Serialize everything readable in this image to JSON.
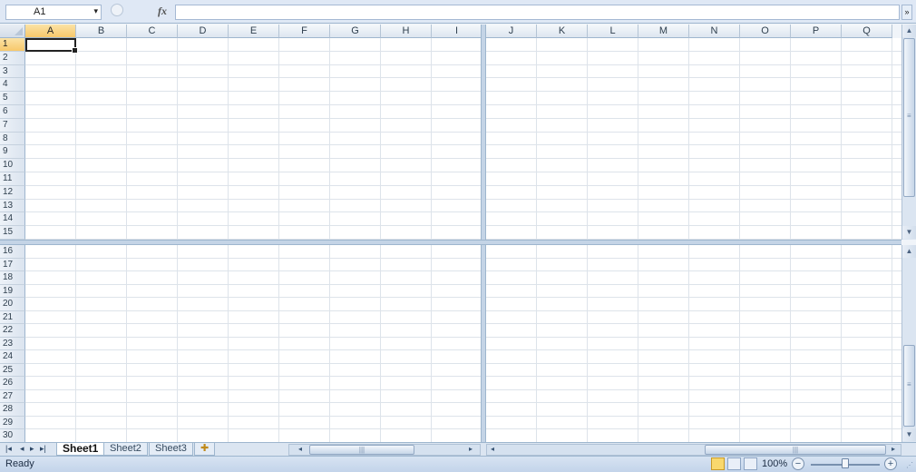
{
  "formula_bar": {
    "name_box": "A1",
    "name_box_arrow": "▾",
    "fx_label": "fx",
    "formula_value": "",
    "expand_arrow": "»"
  },
  "columns_left": [
    "A",
    "B",
    "C",
    "D",
    "E",
    "F",
    "G",
    "H",
    "I"
  ],
  "columns_right": [
    "J",
    "K",
    "L",
    "M",
    "N",
    "O",
    "P",
    "Q"
  ],
  "rows_top": [
    "1",
    "2",
    "3",
    "4",
    "5",
    "6",
    "7",
    "8",
    "9",
    "10",
    "11",
    "12",
    "13",
    "14",
    "15"
  ],
  "rows_bottom": [
    "16",
    "17",
    "18",
    "19",
    "20",
    "21",
    "22",
    "23",
    "24",
    "25",
    "26",
    "27",
    "28",
    "29",
    "30"
  ],
  "selected_cell": "A1",
  "sheet_tabs": [
    {
      "label": "Sheet1",
      "active": true
    },
    {
      "label": "Sheet2",
      "active": false
    },
    {
      "label": "Sheet3",
      "active": false
    }
  ],
  "new_sheet_icon": "insert-worksheet-icon",
  "status": {
    "ready_text": "Ready",
    "zoom_text": "100%",
    "zoom_minus": "−",
    "zoom_plus": "+"
  },
  "colors": {
    "header_selected": "#f7c86b",
    "grid_line": "#dde3ea",
    "chrome": "#dbe5f1"
  }
}
